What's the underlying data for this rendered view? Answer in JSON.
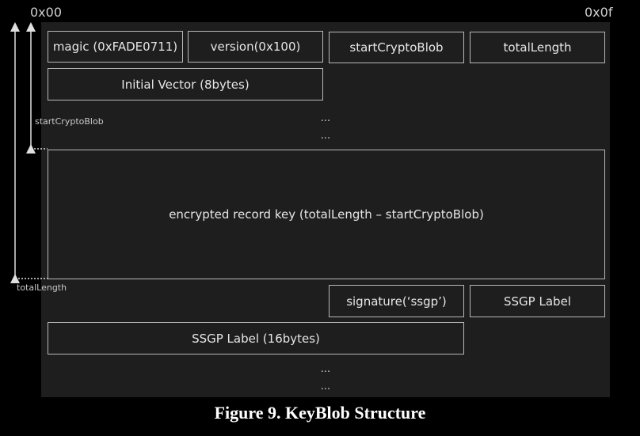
{
  "offsets": {
    "start": "0x00",
    "end": "0x0f"
  },
  "fields": {
    "magic": "magic (0xFADE0711)",
    "version": "version(0x100)",
    "start_crypto_blob": "startCryptoBlob",
    "total_length": "totalLength",
    "initial_vector": "Initial Vector (8bytes)",
    "encrypted_record_key": "encrypted record key (totalLength – startCryptoBlob)",
    "signature": "signature(‘ssgp’)",
    "ssgp_label": "SSGP Label",
    "ssgp_label_16": "SSGP Label (16bytes)"
  },
  "ellipsis": "...",
  "markers": {
    "start_crypto_blob": "startCryptoBlob",
    "total_length": "totalLength"
  },
  "caption": "Figure 9. KeyBlob Structure",
  "colors": {
    "background": "#000000",
    "panel": "#1e1e1e",
    "border": "#b8b8b8",
    "text": "#e6e6e6"
  }
}
